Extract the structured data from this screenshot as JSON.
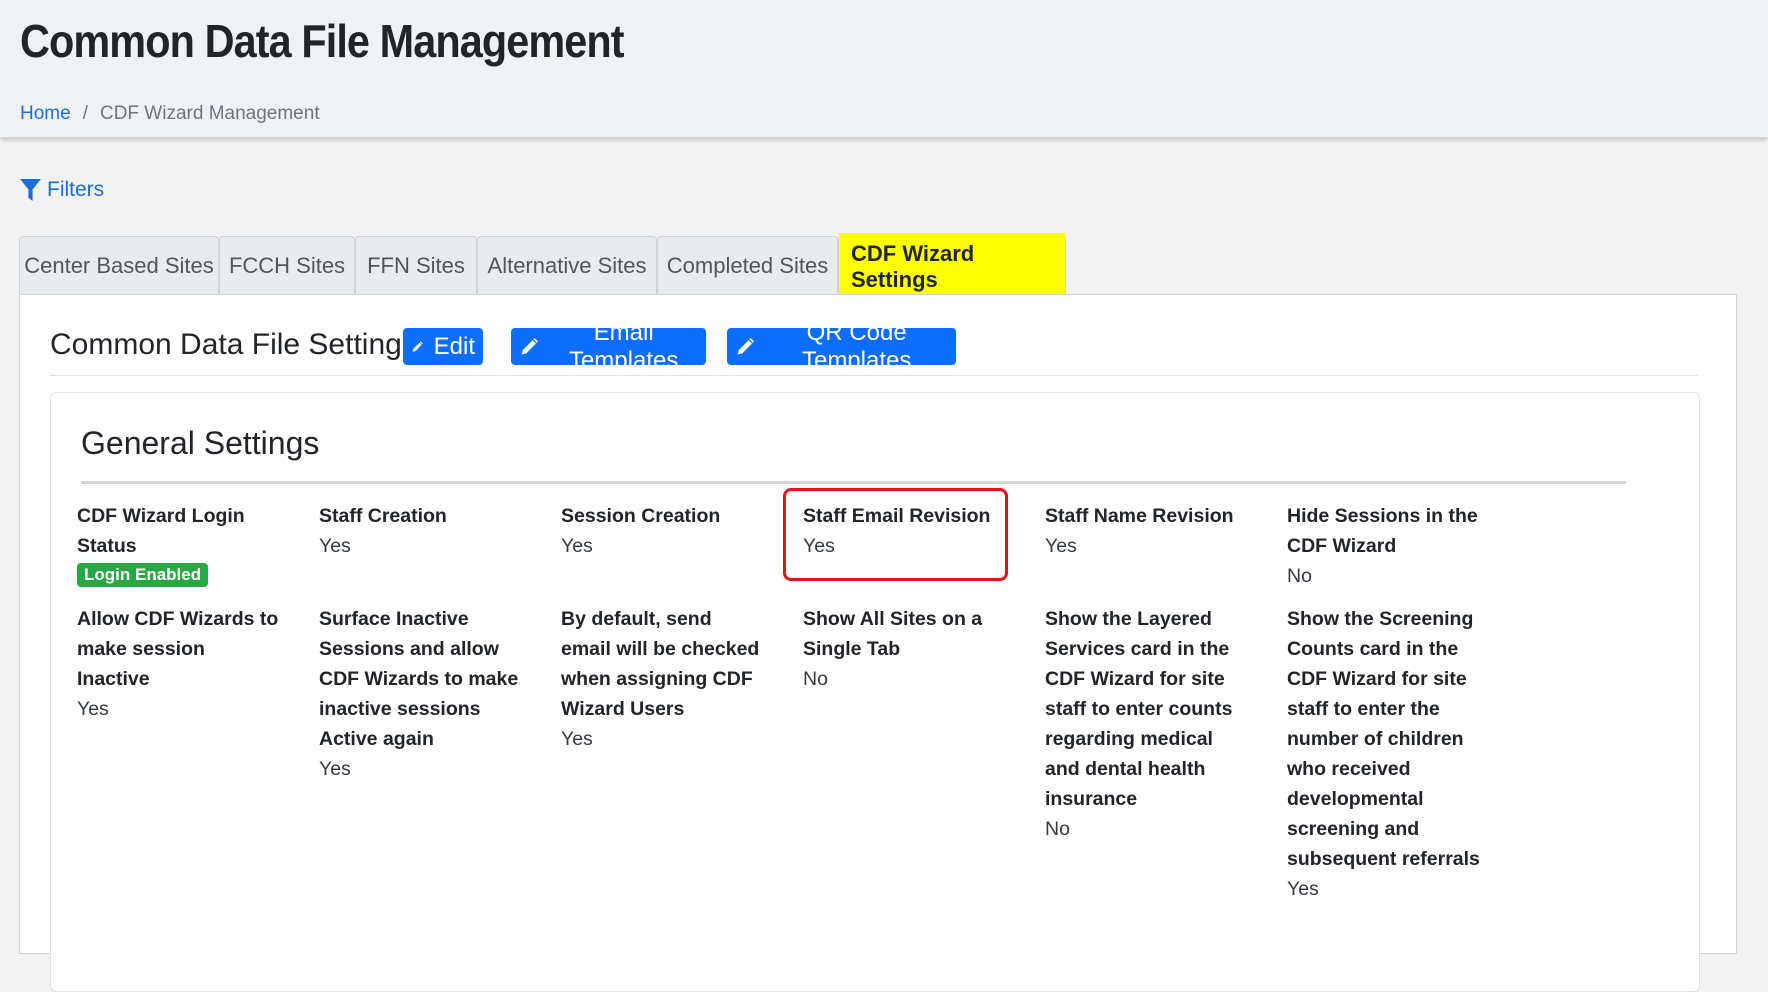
{
  "header": {
    "title": "Common Data File Management",
    "breadcrumb": {
      "home": "Home",
      "separator": "/",
      "current": "CDF Wizard Management"
    }
  },
  "filters": {
    "label": "Filters",
    "icon": "filter-icon"
  },
  "tabs": [
    {
      "label": "Center Based Sites",
      "active": false
    },
    {
      "label": "FCCH Sites",
      "active": false
    },
    {
      "label": "FFN Sites",
      "active": false
    },
    {
      "label": "Alternative Sites",
      "active": false
    },
    {
      "label": "Completed Sites",
      "active": false
    },
    {
      "label": "CDF Wizard Settings",
      "active": true,
      "highlight_color": "#ffff00"
    }
  ],
  "settings_panel": {
    "title": "Common Data File Settings",
    "buttons": [
      {
        "label": "Edit",
        "icon": "pencil-icon"
      },
      {
        "label": "Email Templates",
        "icon": "pencil-icon"
      },
      {
        "label": "QR Code Templates",
        "icon": "pencil-icon"
      }
    ]
  },
  "general_settings": {
    "title": "General Settings",
    "items": [
      {
        "label": "CDF Wizard Login Status",
        "value": "Login Enabled",
        "value_style": "badge",
        "badge_color": "#28a745"
      },
      {
        "label": "Staff Creation",
        "value": "Yes"
      },
      {
        "label": "Session Creation",
        "value": "Yes"
      },
      {
        "label": "Staff Email Revision",
        "value": "Yes",
        "highlighted": true,
        "highlight_color": "#e0141a"
      },
      {
        "label": "Staff Name Revision",
        "value": "Yes"
      },
      {
        "label": "Hide Sessions in the CDF Wizard",
        "value": "No"
      },
      {
        "label": "Allow CDF Wizards to make session Inactive",
        "value": "Yes"
      },
      {
        "label": "Surface Inactive Sessions and allow CDF Wizards to make inactive sessions Active again",
        "value": "Yes"
      },
      {
        "label": "By default, send email will be checked when assigning CDF Wizard Users",
        "value": "Yes"
      },
      {
        "label": "Show All Sites on a Single Tab",
        "value": "No"
      },
      {
        "label": "Show the Layered Services card in the CDF Wizard for site staff to enter counts regarding medical and dental health insurance",
        "value": "No"
      },
      {
        "label": "Show the Screening Counts card in the CDF Wizard for site staff to enter the number of children who received developmental screening and subsequent referrals",
        "value": "Yes"
      }
    ]
  },
  "colors": {
    "primary": "#0d6efd",
    "link": "#1a6fd6",
    "success": "#28a745",
    "header_bg": "#f1f2f5"
  }
}
